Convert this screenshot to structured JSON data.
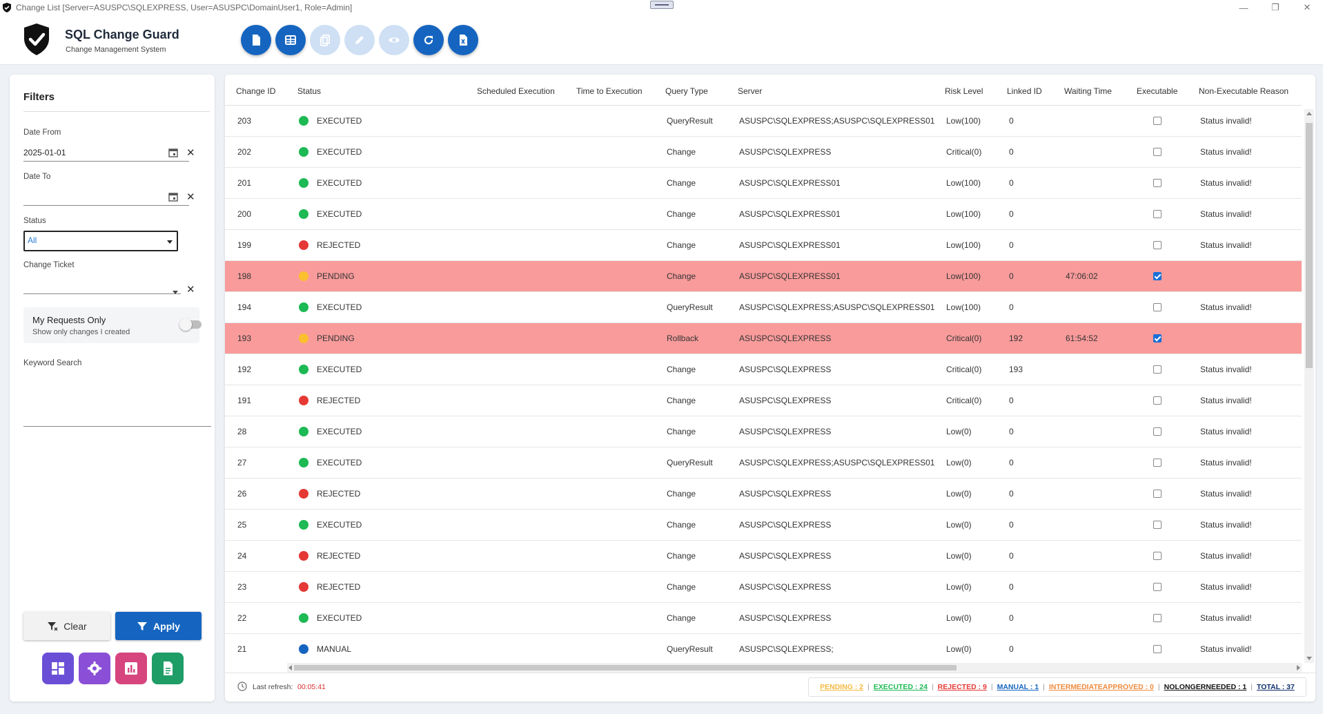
{
  "window": {
    "title": "Change List [Server=ASUSPC\\SQLEXPRESS, User=ASUSPC\\DomainUser1, Role=Admin]",
    "controls": [
      "minimize-icon",
      "maximize-icon",
      "close-icon"
    ]
  },
  "header": {
    "brand_title": "SQL Change Guard",
    "brand_subtitle": "Change Management System",
    "toolbar": [
      {
        "name": "new-document-button",
        "icon": "document-icon",
        "enabled": true
      },
      {
        "name": "grid-view-button",
        "icon": "table-icon",
        "enabled": true
      },
      {
        "name": "copy-button",
        "icon": "copy-icon",
        "enabled": false
      },
      {
        "name": "edit-button",
        "icon": "pencil-icon",
        "enabled": false
      },
      {
        "name": "view-button",
        "icon": "eye-icon",
        "enabled": false
      },
      {
        "name": "refresh-button",
        "icon": "refresh-icon",
        "enabled": true
      },
      {
        "name": "export-excel-button",
        "icon": "excel-icon",
        "enabled": true
      }
    ]
  },
  "filters": {
    "title": "Filters",
    "date_from_label": "Date From",
    "date_from_value": "2025-01-01",
    "date_to_label": "Date To",
    "date_to_value": "",
    "status_label": "Status",
    "status_value": "All",
    "ticket_label": "Change Ticket",
    "ticket_value": "",
    "my_requests_label": "My Requests Only",
    "my_requests_sub": "Show only changes I created",
    "my_requests_on": false,
    "keyword_label": "Keyword Search",
    "keyword_value": "",
    "clear_label": "Clear",
    "apply_label": "Apply",
    "app_buttons": [
      {
        "name": "dashboard-button",
        "icon": "dashboard-icon",
        "color": "#6a4fd6"
      },
      {
        "name": "settings-button",
        "icon": "gear-icon",
        "color": "#8a4fd6"
      },
      {
        "name": "reports-button",
        "icon": "chart-icon",
        "color": "#d6457e"
      },
      {
        "name": "documents-button",
        "icon": "document-icon",
        "color": "#1f9d67"
      }
    ]
  },
  "grid": {
    "columns": [
      "Change ID",
      "Status",
      "Scheduled Execution",
      "Time to Execution",
      "Query Type",
      "Server",
      "Risk Level",
      "Linked ID",
      "Waiting Time",
      "Executable",
      "Non-Executable Reason"
    ],
    "rows": [
      {
        "id": "203",
        "status": "EXECUTED",
        "color": "#1db954",
        "qtype": "QueryResult",
        "server": "ASUSPC\\SQLEXPRESS;ASUSPC\\SQLEXPRESS01",
        "risk": "Low(100)",
        "linked": "0",
        "wait": "",
        "exec": false,
        "reason": "Status invalid!",
        "hl": false
      },
      {
        "id": "202",
        "status": "EXECUTED",
        "color": "#1db954",
        "qtype": "Change",
        "server": "ASUSPC\\SQLEXPRESS",
        "risk": "Critical(0)",
        "linked": "0",
        "wait": "",
        "exec": false,
        "reason": "Status invalid!",
        "hl": false
      },
      {
        "id": "201",
        "status": "EXECUTED",
        "color": "#1db954",
        "qtype": "Change",
        "server": "ASUSPC\\SQLEXPRESS01",
        "risk": "Low(100)",
        "linked": "0",
        "wait": "",
        "exec": false,
        "reason": "Status invalid!",
        "hl": false
      },
      {
        "id": "200",
        "status": "EXECUTED",
        "color": "#1db954",
        "qtype": "Change",
        "server": "ASUSPC\\SQLEXPRESS01",
        "risk": "Low(100)",
        "linked": "0",
        "wait": "",
        "exec": false,
        "reason": "Status invalid!",
        "hl": false
      },
      {
        "id": "199",
        "status": "REJECTED",
        "color": "#e53935",
        "qtype": "Change",
        "server": "ASUSPC\\SQLEXPRESS01",
        "risk": "Low(100)",
        "linked": "0",
        "wait": "",
        "exec": false,
        "reason": "Status invalid!",
        "hl": false
      },
      {
        "id": "198",
        "status": "PENDING",
        "color": "#fbc02d",
        "qtype": "Change",
        "server": "ASUSPC\\SQLEXPRESS01",
        "risk": "Low(100)",
        "linked": "0",
        "wait": "47:06:02",
        "exec": true,
        "reason": "",
        "hl": true
      },
      {
        "id": "194",
        "status": "EXECUTED",
        "color": "#1db954",
        "qtype": "QueryResult",
        "server": "ASUSPC\\SQLEXPRESS;ASUSPC\\SQLEXPRESS01",
        "risk": "Low(100)",
        "linked": "0",
        "wait": "",
        "exec": false,
        "reason": "Status invalid!",
        "hl": false
      },
      {
        "id": "193",
        "status": "PENDING",
        "color": "#fbc02d",
        "qtype": "Rollback",
        "server": "ASUSPC\\SQLEXPRESS",
        "risk": "Critical(0)",
        "linked": "192",
        "wait": "61:54:52",
        "exec": true,
        "reason": "",
        "hl": true
      },
      {
        "id": "192",
        "status": "EXECUTED",
        "color": "#1db954",
        "qtype": "Change",
        "server": "ASUSPC\\SQLEXPRESS",
        "risk": "Critical(0)",
        "linked": "193",
        "wait": "",
        "exec": false,
        "reason": "Status invalid!",
        "hl": false
      },
      {
        "id": "191",
        "status": "REJECTED",
        "color": "#e53935",
        "qtype": "Change",
        "server": "ASUSPC\\SQLEXPRESS",
        "risk": "Critical(0)",
        "linked": "0",
        "wait": "",
        "exec": false,
        "reason": "Status invalid!",
        "hl": false
      },
      {
        "id": "28",
        "status": "EXECUTED",
        "color": "#1db954",
        "qtype": "Change",
        "server": "ASUSPC\\SQLEXPRESS",
        "risk": "Low(0)",
        "linked": "0",
        "wait": "",
        "exec": false,
        "reason": "Status invalid!",
        "hl": false
      },
      {
        "id": "27",
        "status": "EXECUTED",
        "color": "#1db954",
        "qtype": "QueryResult",
        "server": "ASUSPC\\SQLEXPRESS;ASUSPC\\SQLEXPRESS01",
        "risk": "Low(0)",
        "linked": "0",
        "wait": "",
        "exec": false,
        "reason": "Status invalid!",
        "hl": false
      },
      {
        "id": "26",
        "status": "REJECTED",
        "color": "#e53935",
        "qtype": "Change",
        "server": "ASUSPC\\SQLEXPRESS",
        "risk": "Low(0)",
        "linked": "0",
        "wait": "",
        "exec": false,
        "reason": "Status invalid!",
        "hl": false
      },
      {
        "id": "25",
        "status": "EXECUTED",
        "color": "#1db954",
        "qtype": "Change",
        "server": "ASUSPC\\SQLEXPRESS",
        "risk": "Low(0)",
        "linked": "0",
        "wait": "",
        "exec": false,
        "reason": "Status invalid!",
        "hl": false
      },
      {
        "id": "24",
        "status": "REJECTED",
        "color": "#e53935",
        "qtype": "Change",
        "server": "ASUSPC\\SQLEXPRESS",
        "risk": "Low(0)",
        "linked": "0",
        "wait": "",
        "exec": false,
        "reason": "Status invalid!",
        "hl": false
      },
      {
        "id": "23",
        "status": "REJECTED",
        "color": "#e53935",
        "qtype": "Change",
        "server": "ASUSPC\\SQLEXPRESS",
        "risk": "Low(0)",
        "linked": "0",
        "wait": "",
        "exec": false,
        "reason": "Status invalid!",
        "hl": false
      },
      {
        "id": "22",
        "status": "EXECUTED",
        "color": "#1db954",
        "qtype": "Change",
        "server": "ASUSPC\\SQLEXPRESS",
        "risk": "Low(0)",
        "linked": "0",
        "wait": "",
        "exec": false,
        "reason": "Status invalid!",
        "hl": false
      },
      {
        "id": "21",
        "status": "MANUAL",
        "color": "#1565c0",
        "qtype": "QueryResult",
        "server": "ASUSPC\\SQLEXPRESS;",
        "risk": "Low(0)",
        "linked": "0",
        "wait": "",
        "exec": false,
        "reason": "Status invalid!",
        "hl": false
      }
    ]
  },
  "footer": {
    "last_refresh_label": "Last refresh:",
    "last_refresh_value": "00:05:41",
    "counts": [
      {
        "label": "PENDING : 2",
        "color": "#f5b942"
      },
      {
        "label": "EXECUTED : 24",
        "color": "#1db954"
      },
      {
        "label": "REJECTED : 9",
        "color": "#e53935"
      },
      {
        "label": "MANUAL : 1",
        "color": "#1565c0"
      },
      {
        "label": "INTERMEDIATEAPPROVED : 0",
        "color": "#f08a3c"
      },
      {
        "label": "NOLONGERNEEDED : 1",
        "color": "#111111"
      },
      {
        "label": "TOTAL : 37",
        "color": "#0d2f6b"
      }
    ]
  }
}
